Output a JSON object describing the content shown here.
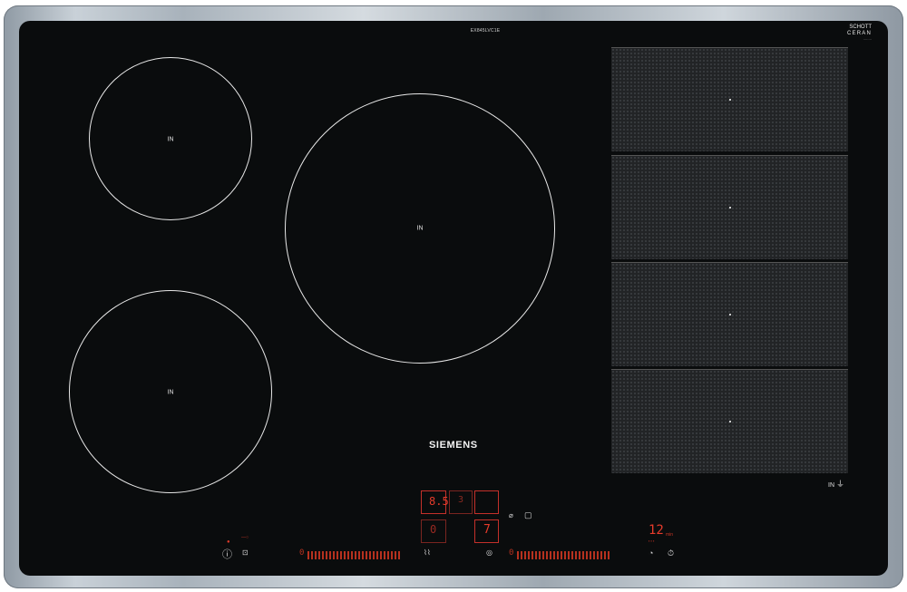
{
  "hob": {
    "model_number": "EX845LVC1E",
    "glass_brand": "SCHOTT",
    "glass_brand_line2": "CERAN",
    "brand": "SIEMENS",
    "zones": [
      {
        "label": "IN"
      },
      {
        "label": "IN"
      },
      {
        "label": "IN"
      }
    ],
    "flex_zone_label": "IN",
    "colors": {
      "glass": "#0a0c0d",
      "display_red": "#d23a2a",
      "frame": "#b9c1c8"
    }
  },
  "controls": {
    "power_level_display": "8.5",
    "power_level_display_2": "3",
    "zone_display_left": "0",
    "zone_display_right": "7",
    "timer_display": "12",
    "timer_unit": "min",
    "slider_left_start": "0",
    "slider_right_start": "0"
  }
}
